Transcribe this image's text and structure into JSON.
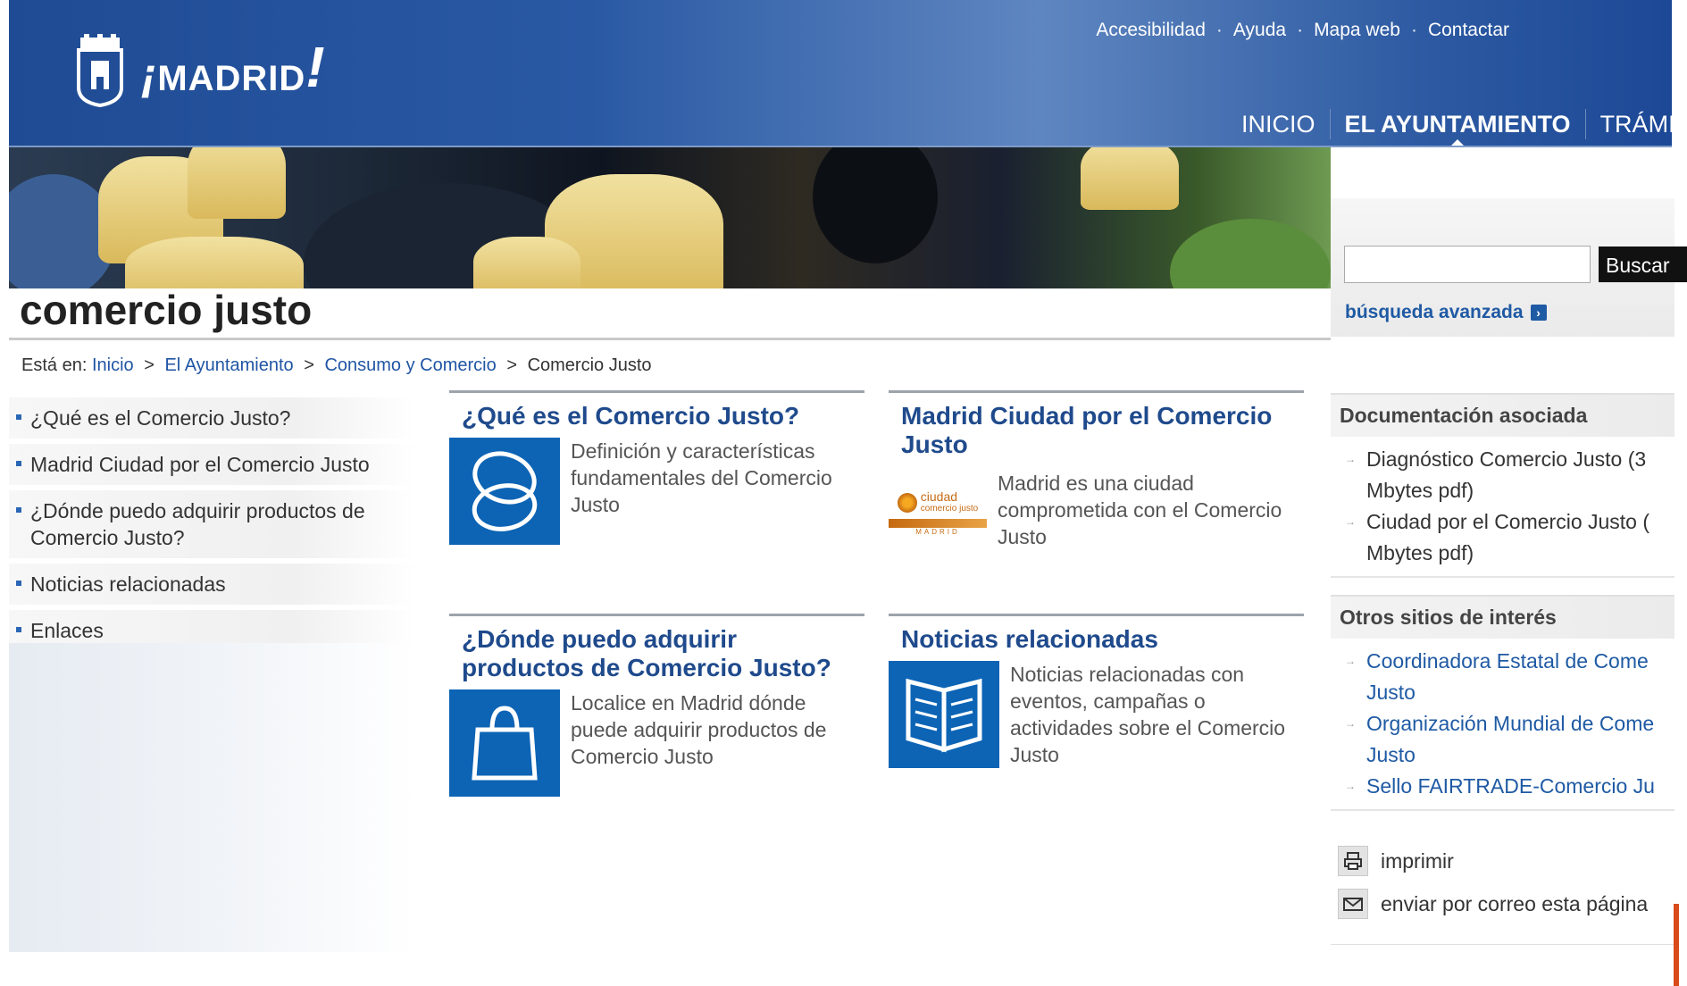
{
  "header": {
    "logo_text": "MADRID",
    "utility_links": [
      "Accesibilidad",
      "Ayuda",
      "Mapa web",
      "Contactar"
    ],
    "main_nav": [
      "INICIO",
      "EL AYUNTAMIENTO",
      "TRÁMI"
    ]
  },
  "page": {
    "title": "comercio justo"
  },
  "breadcrumb": {
    "prefix": "Está en:",
    "items": [
      "Inicio",
      "El Ayuntamiento",
      "Consumo y Comercio",
      "Comercio Justo"
    ]
  },
  "left_nav": [
    "¿Qué es el Comercio Justo?",
    "Madrid Ciudad por el Comercio Justo",
    "¿Dónde puedo adquirir productos de Comercio Justo?",
    "Noticias relacionadas",
    "Enlaces"
  ],
  "cards": [
    {
      "title": "¿Qué es el Comercio Justo?",
      "desc": "Definición y características fundamentales del Comercio Justo",
      "icon": "circles-icon"
    },
    {
      "title": "Madrid Ciudad por el Comercio Justo",
      "desc": "Madrid es una ciudad comprometida con el Comercio Justo",
      "icon": "ciudad-comercio-justo-logo",
      "logo_top": "ciudad",
      "logo_bottom": "comercio justo",
      "logo_city": "MADRID"
    },
    {
      "title": "¿Dónde puedo adquirir productos de Comercio Justo?",
      "desc": "Localice en Madrid dónde puede adquirir productos de Comercio Justo",
      "icon": "shopping-bag-icon"
    },
    {
      "title": "Noticias relacionadas",
      "desc": "Noticias relacionadas con eventos, campañas o actividades sobre el Comercio Justo",
      "icon": "open-book-icon"
    }
  ],
  "search": {
    "button": "Buscar",
    "advanced": "búsqueda avanzada",
    "value": ""
  },
  "documentation": {
    "title": "Documentación asociada",
    "items": [
      {
        "line1": "Diagnóstico Comercio Justo (3",
        "line2": "Mbytes pdf)"
      },
      {
        "line1": "Ciudad por el Comercio Justo (",
        "line2": "Mbytes pdf)"
      }
    ]
  },
  "other_sites": {
    "title": "Otros sitios de interés",
    "items": [
      {
        "line1": "Coordinadora Estatal de Come",
        "line2": "Justo"
      },
      {
        "line1": "Organización Mundial de Come",
        "line2": "Justo"
      },
      {
        "line1": "Sello FAIRTRADE-Comercio Ju",
        "line2": ""
      }
    ]
  },
  "actions": {
    "print": "imprimir",
    "email": "enviar por correo esta página"
  },
  "colors": {
    "header_blue": "#1f4b94",
    "link_blue": "#1f5aa4",
    "tile_blue": "#0d64b5"
  }
}
